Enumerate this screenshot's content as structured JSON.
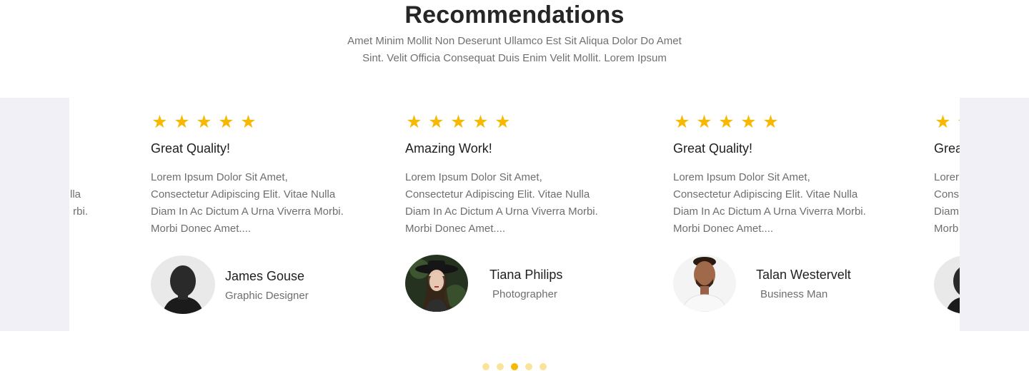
{
  "header": {
    "title": "Recommendations",
    "subtitle_line1": "Amet Minim Mollit Non Deserunt Ullamco Est Sit Aliqua Dolor Do Amet",
    "subtitle_line2": "Sint. Velit Officia Consequat Duis Enim Velit Mollit. Lorem Ipsum"
  },
  "colors": {
    "star": "#f6b801",
    "dot_active": "#f6b801",
    "dot_inactive": "#fbe49a",
    "edge_panel": "#f0f0f6"
  },
  "partial_left": {
    "line2": "lla",
    "line3": "rbi."
  },
  "cards": [
    {
      "rating": 5,
      "heading": "Great Quality!",
      "lines": [
        "Lorem Ipsum Dolor Sit Amet,",
        "Consectetur Adipiscing Elit. Vitae Nulla",
        "Diam In Ac Dictum A Urna Viverra Morbi.",
        "Morbi Donec Amet...."
      ],
      "name": "James Gouse",
      "role": "Graphic Designer"
    },
    {
      "rating": 5,
      "heading": "Amazing Work!",
      "lines": [
        "Lorem Ipsum Dolor Sit Amet,",
        "Consectetur Adipiscing Elit. Vitae Nulla",
        "Diam In Ac Dictum A Urna Viverra Morbi.",
        "Morbi Donec Amet...."
      ],
      "name": "Tiana Philips",
      "role": "Photographer"
    },
    {
      "rating": 5,
      "heading": "Great Quality!",
      "lines": [
        "Lorem Ipsum Dolor Sit Amet,",
        "Consectetur Adipiscing Elit. Vitae Nulla",
        "Diam In Ac Dictum A Urna Viverra Morbi.",
        "Morbi Donec Amet...."
      ],
      "name": "Talan Westervelt",
      "role": "Business Man"
    }
  ],
  "partial_right": {
    "heading": "Grea",
    "line1": "Lorer",
    "line2": "Cons",
    "line3": "Diam",
    "line4": "Morb"
  },
  "pagination": {
    "count": 5,
    "active_index": 2
  }
}
